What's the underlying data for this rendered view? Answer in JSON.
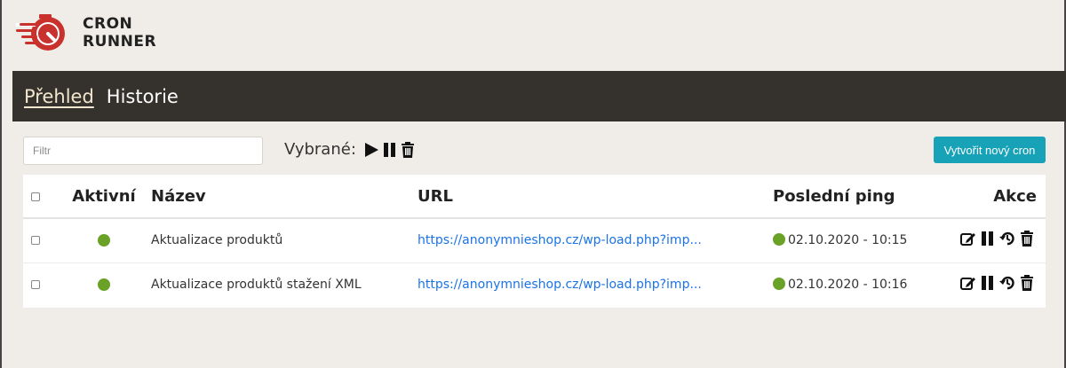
{
  "app": {
    "logo_line1": "CRON",
    "logo_line2": "RUNNER",
    "accent_color": "#c9312c"
  },
  "nav": {
    "items": [
      {
        "label": "Přehled",
        "active": true
      },
      {
        "label": "Historie",
        "active": false
      }
    ]
  },
  "toolbar": {
    "filter_placeholder": "Filtr",
    "filter_value": "",
    "selected_label": "Vybrané:",
    "selected_icons": [
      "play-icon",
      "pause-icon",
      "trash-icon"
    ],
    "create_label": "Vytvořit nový cron",
    "create_color": "#17a2b8"
  },
  "table": {
    "headers": {
      "active": "Aktivní",
      "name": "Název",
      "url": "URL",
      "last_ping": "Poslední ping",
      "actions": "Akce"
    },
    "rows": [
      {
        "active": true,
        "name": "Aktualizace produktů",
        "url": "https://anonymnieshop.cz/wp-load.php?imp...",
        "last_ping": "02.10.2020 - 10:15",
        "actions": [
          "edit-icon",
          "pause-icon",
          "history-icon",
          "trash-icon"
        ]
      },
      {
        "active": true,
        "name": "Aktualizace produktů stažení XML",
        "url": "https://anonymnieshop.cz/wp-load.php?imp...",
        "last_ping": "02.10.2020 - 10:16",
        "actions": [
          "edit-icon",
          "pause-icon",
          "history-icon",
          "trash-icon"
        ]
      }
    ],
    "status_color": "#6aa228"
  }
}
